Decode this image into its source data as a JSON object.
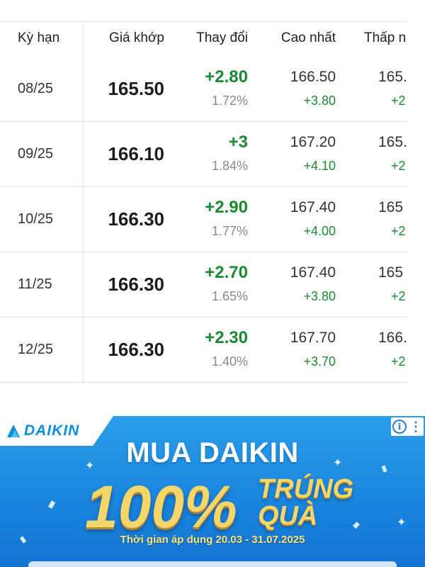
{
  "table": {
    "headers": {
      "term": "Kỳ hạn",
      "price": "Giá khớp",
      "change": "Thay đổi",
      "high": "Cao nhất",
      "low": "Thấp n"
    },
    "rows": [
      {
        "term": "08/25",
        "price": "165.50",
        "change": "+2.80",
        "change_pct": "1.72%",
        "high": "166.50",
        "high_change": "+3.80",
        "low": "165.",
        "low_change": "+2"
      },
      {
        "term": "09/25",
        "price": "166.10",
        "change": "+3",
        "change_pct": "1.84%",
        "high": "167.20",
        "high_change": "+4.10",
        "low": "165.",
        "low_change": "+2"
      },
      {
        "term": "10/25",
        "price": "166.30",
        "change": "+2.90",
        "change_pct": "1.77%",
        "high": "167.40",
        "high_change": "+4.00",
        "low": "165",
        "low_change": "+2"
      },
      {
        "term": "11/25",
        "price": "166.30",
        "change": "+2.70",
        "change_pct": "1.65%",
        "high": "167.40",
        "high_change": "+3.80",
        "low": "165",
        "low_change": "+2"
      },
      {
        "term": "12/25",
        "price": "166.30",
        "change": "+2.30",
        "change_pct": "1.40%",
        "high": "167.70",
        "high_change": "+3.70",
        "low": "166.",
        "low_change": "+2"
      }
    ]
  },
  "ad": {
    "brand": "DAIKIN",
    "headline": "MUA DAIKIN",
    "big_percent": "100%",
    "win_line1": "TRÚNG",
    "win_line2": "QUÀ",
    "period": "Thời gian áp dụng 20.03 - 31.07.2025",
    "adchoice_info": "i",
    "adchoice_menu": "⋮"
  },
  "colors": {
    "positive": "#1b8a32",
    "ad_blue": "#1a86de",
    "gold": "#f5d66a",
    "brand_blue": "#0a8fd8"
  }
}
